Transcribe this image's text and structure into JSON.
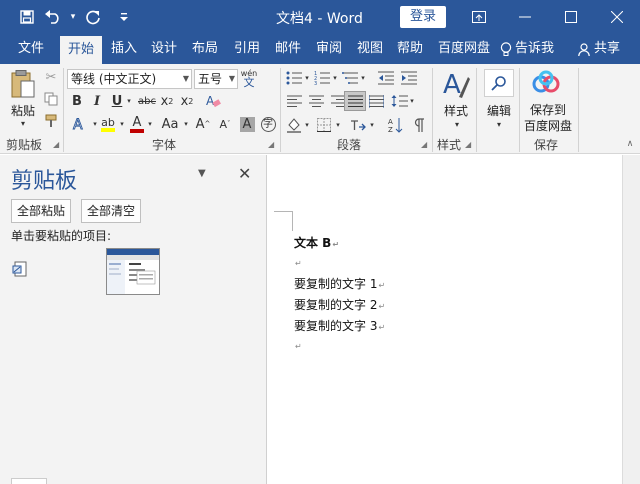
{
  "titlebar": {
    "title": "文档4  -  Word",
    "login_label": "登录",
    "qat_icons": [
      "save-icon",
      "undo-icon",
      "redo-icon",
      "customize-qat-icon"
    ],
    "window_controls": [
      "ribbon-display-icon",
      "minimize-icon",
      "maximize-icon",
      "close-icon"
    ]
  },
  "tabs": [
    {
      "label": "文件",
      "active": false
    },
    {
      "label": "开始",
      "active": true
    },
    {
      "label": "插入",
      "active": false
    },
    {
      "label": "设计",
      "active": false
    },
    {
      "label": "布局",
      "active": false
    },
    {
      "label": "引用",
      "active": false
    },
    {
      "label": "邮件",
      "active": false
    },
    {
      "label": "审阅",
      "active": false
    },
    {
      "label": "视图",
      "active": false
    },
    {
      "label": "帮助",
      "active": false
    },
    {
      "label": "百度网盘",
      "active": false
    }
  ],
  "tell_me": "告诉我",
  "share": "共享",
  "ribbon": {
    "clipboard": {
      "group_label": "剪贴板",
      "paste_label": "粘贴"
    },
    "font": {
      "group_label": "字体",
      "font_name": "等线 (中文正文)",
      "font_size": "五号",
      "wen_label": "wén"
    },
    "paragraph": {
      "group_label": "段落"
    },
    "styles": {
      "group_label": "样式",
      "styles_label": "样式"
    },
    "editing": {
      "editing_label": "编辑"
    },
    "save": {
      "group_label": "保存",
      "save_label_line1": "保存到",
      "save_label_line2": "百度网盘"
    }
  },
  "pane": {
    "title": "剪贴板",
    "paste_all": "全部粘贴",
    "clear_all": "全部清空",
    "hint": "单击要粘贴的项目:"
  },
  "document": {
    "paragraphs": [
      "文本 B",
      "",
      "要复制的文字 1",
      "要复制的文字 2",
      "要复制的文字 3",
      ""
    ]
  },
  "colors": {
    "accent": "#2b579a",
    "highlight": "#ffff00",
    "font_color": "#c00000"
  }
}
